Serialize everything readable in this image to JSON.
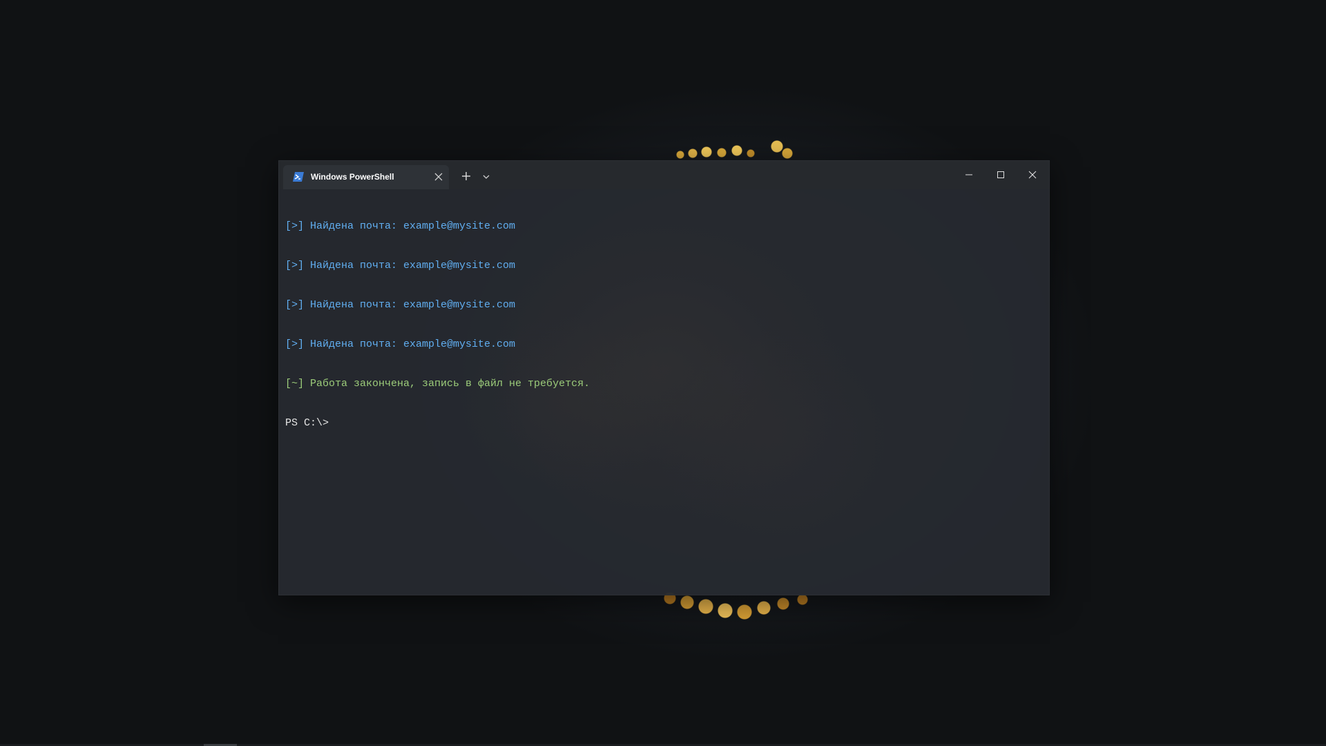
{
  "window": {
    "tab_title": "Windows PowerShell",
    "tab_icon": "powershell-icon"
  },
  "terminal": {
    "lines": [
      {
        "text": "[>] Найдена почта: example@mysite.com",
        "color": "#61aff2"
      },
      {
        "text": "[>] Найдена почта: example@mysite.com",
        "color": "#61aff2"
      },
      {
        "text": "[>] Найдена почта: example@mysite.com",
        "color": "#61aff2"
      },
      {
        "text": "[>] Найдена почта: example@mysite.com",
        "color": "#61aff2"
      },
      {
        "text": "[~] Работа закончена, запись в файл не требуется.",
        "color": "#9ccc7a"
      },
      {
        "text": "PS C:\\>",
        "color": "#e6e6e6"
      }
    ]
  },
  "colors": {
    "desktop_bg": "#121518",
    "window_bg": "#262a30",
    "titlebar_bg": "#26292d",
    "tab_bg": "#2e3237",
    "accent_blue": "#61aff2",
    "accent_green": "#9ccc7a"
  },
  "icons": [
    "powershell-icon",
    "close-icon",
    "plus-icon",
    "chevron-down-icon",
    "minimize-icon",
    "maximize-icon"
  ]
}
